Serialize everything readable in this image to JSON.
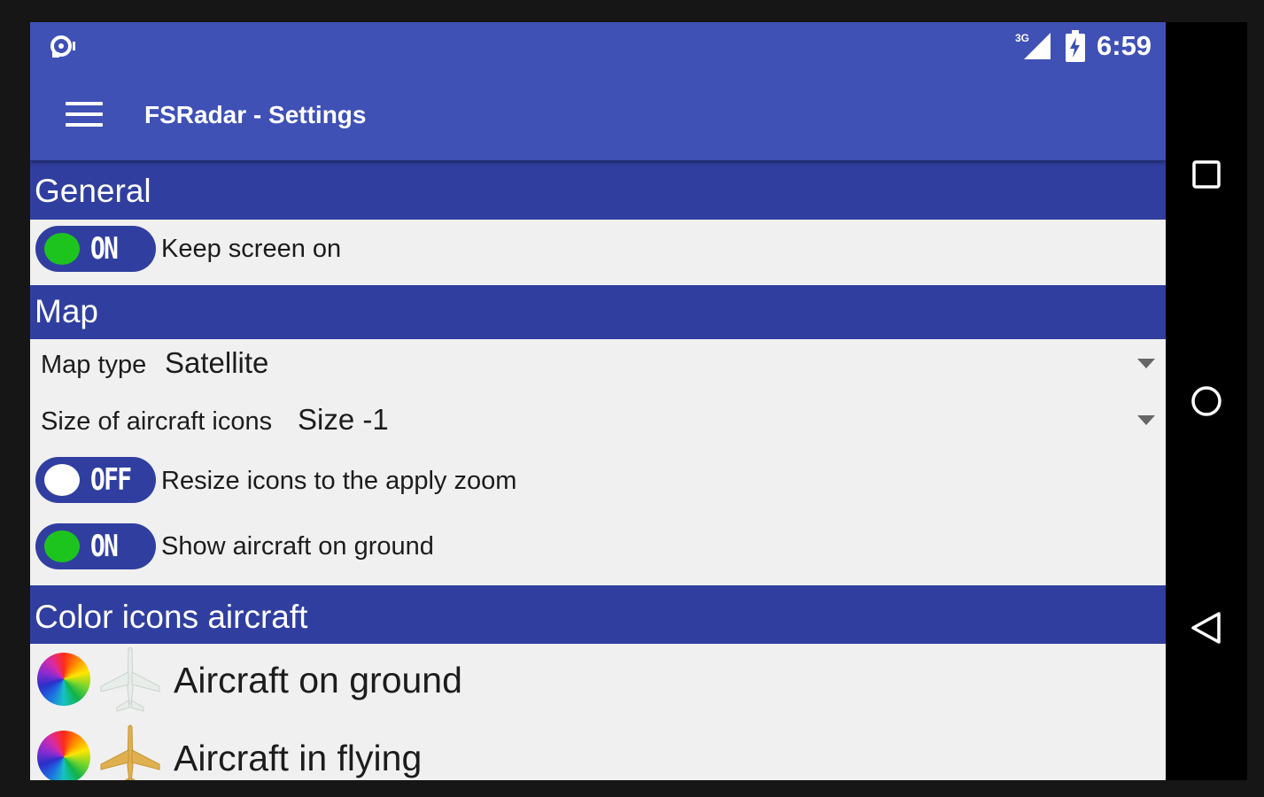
{
  "status_bar": {
    "notification_icon": "notification-icon",
    "network_badge": "3G",
    "signal_icon": "signal-icon",
    "battery_icon": "battery-charging-icon",
    "time": "6:59"
  },
  "toolbar": {
    "menu_icon": "hamburger-menu-icon",
    "title": "FSRadar - Settings"
  },
  "sections": {
    "general": {
      "header": "General",
      "keep_screen_on": {
        "state": "ON",
        "label": "Keep screen on"
      }
    },
    "map": {
      "header": "Map",
      "map_type": {
        "label": "Map type",
        "value": "Satellite"
      },
      "icon_size": {
        "label": "Size of aircraft icons",
        "value": "Size -1"
      },
      "resize_icons": {
        "state": "OFF",
        "label": "Resize icons to the apply zoom"
      },
      "show_on_ground": {
        "state": "ON",
        "label": "Show aircraft on ground"
      }
    },
    "color_icons": {
      "header": "Color icons aircraft",
      "items": [
        {
          "label": "Aircraft on ground",
          "plane_color": "#e8ede9",
          "wheel_icon": "color-wheel-icon"
        },
        {
          "label": "Aircraft in flying",
          "plane_color": "#e0b050",
          "wheel_icon": "color-wheel-icon"
        }
      ]
    }
  },
  "nav_bar": {
    "recents_icon": "square-recents-icon",
    "home_icon": "circle-home-icon",
    "back_icon": "triangle-back-icon"
  },
  "colors": {
    "primary": "#3f51b5",
    "primary_dark": "#303f9f",
    "toggle_on": "#1ec41e",
    "background": "#f0f0f0"
  }
}
